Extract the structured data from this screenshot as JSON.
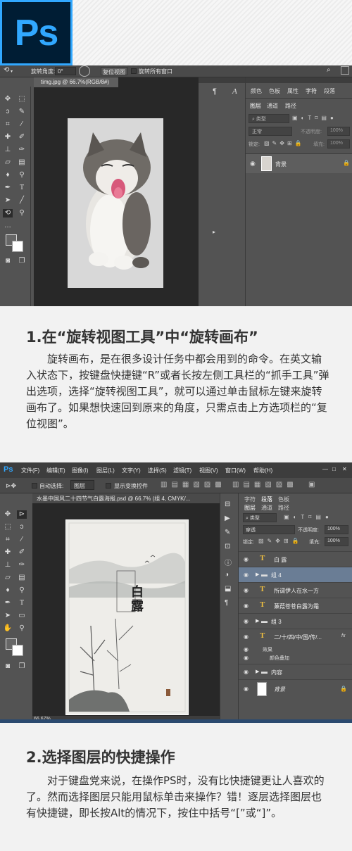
{
  "header": {
    "logo_text": "Ps",
    "brand_color": "#31a8ff"
  },
  "screenshot1": {
    "optbar": {
      "rotate_label": "旋转角度:",
      "rotate_value": "0°",
      "reset_view": "复位视图",
      "rotate_all": "旋转所有窗口"
    },
    "doc_tab": "timg.jpg @ 66.7%(RGB/8#)",
    "panel_tabs": [
      "颜色",
      "色板",
      "属性",
      "字符",
      "段落"
    ],
    "layer_tabs": [
      "图层",
      "通道",
      "路径"
    ],
    "search_placeholder": "类型",
    "blend_mode": "正常",
    "opacity_label": "不透明度:",
    "opacity_value": "100%",
    "lock_label": "锁定:",
    "fill_label": "填充:",
    "fill_value": "100%",
    "layer_name": "背景"
  },
  "section1": {
    "title": "1.在“旋转视图工具”中“旋转画布”",
    "body": "旋转画布，是在很多设计任务中都会用到的命令。在英文输入状态下，按键盘快捷键“R”或者长按左侧工具栏的“抓手工具”弹出选项，选择“旋转视图工具”，就可以通过单击鼠标左键来旋转画布了。如果想快速回到原来的角度，只需点击上方选项栏的“复位视图”。"
  },
  "screenshot2": {
    "menu": [
      "Ps",
      "文件(F)",
      "编辑(E)",
      "图像(I)",
      "图层(L)",
      "文字(Y)",
      "选择(S)",
      "滤镜(T)",
      "视图(V)",
      "窗口(W)",
      "帮助(H)"
    ],
    "optbar": {
      "auto_select": "自动选择:",
      "auto_select_value": "图层",
      "show_transform": "显示变换控件"
    },
    "doc_tab": "水墨中国风二十四节气白露海报.psd @ 66.7% (组 4, CMYK/...",
    "zoom": "66.67%",
    "poster_title": "白露",
    "panel_tabs": [
      "字符",
      "段落",
      "色板"
    ],
    "layer_tabs": [
      "图层",
      "通道",
      "路径"
    ],
    "search_placeholder": "类型",
    "blend_mode": "穿透",
    "opacity_label": "不透明度:",
    "opacity_value": "100%",
    "lock_label": "锁定:",
    "fill_label": "填充:",
    "fill_value": "100%",
    "layers": [
      {
        "type": "text",
        "name": "白 露"
      },
      {
        "type": "group",
        "name": "组 4",
        "selected": true
      },
      {
        "type": "text",
        "name": "所谓伊人在水一方"
      },
      {
        "type": "text",
        "name": "蒹葭苍苍白露为霜"
      },
      {
        "type": "group",
        "name": "组 3"
      },
      {
        "type": "text",
        "name": "二/十/四/中/国/传/..."
      },
      {
        "type": "effect",
        "name": "效果"
      },
      {
        "type": "effect",
        "name": "颜色叠加"
      },
      {
        "type": "group",
        "name": "内容"
      },
      {
        "type": "image",
        "name": "背景"
      }
    ],
    "fx_label": "fx"
  },
  "section2": {
    "title": "2.选择图层的快捷操作",
    "body": "对于键盘党来说，在操作PS时，没有比快捷键更让人喜欢的了。然而选择图层只能用鼠标单击来操作？错！逐层选择图层也有快捷键，即长按Alt的情况下，按住中括号“[”或“]”。"
  }
}
